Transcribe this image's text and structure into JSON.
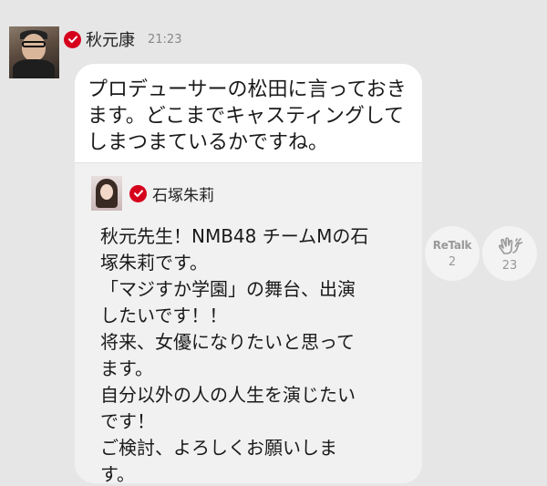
{
  "message": {
    "author": "秋元康",
    "time": "21:23",
    "text": "プロデューサーの松田に言っておき\nます。どこまでキャスティングして\nしまつまているかですね。"
  },
  "quoted": {
    "author": "石塚朱莉",
    "text": "秋元先生！NMB48 チームMの石\n塚朱莉です。\n「マジすか学園」の舞台、出演\nしたいです！！\n将来、女優になりたいと思って\nます。\n自分以外の人の人生を演じたい\nです！\nご検討、よろしくお願いしま\nす。"
  },
  "actions": {
    "retalk_label": "ReTalk",
    "retalk_count": "2",
    "clap_count": "23"
  },
  "icons": {
    "verified": "verified-check-icon",
    "clap": "clap-hands-icon"
  },
  "colors": {
    "background": "#e6e6e6",
    "verified_badge": "#d6001c",
    "bubble": "#ffffff",
    "quote_background": "#f1f1f1"
  }
}
